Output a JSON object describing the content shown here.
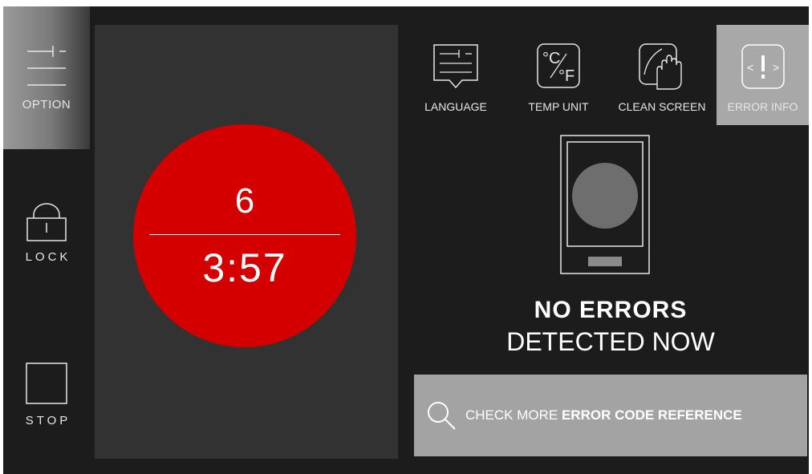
{
  "sidebar": {
    "option_label": "OPTION",
    "lock_label": "LOCK",
    "stop_label": "STOP",
    "option_icon": "option-sliders-icon",
    "lock_icon": "lock-icon",
    "stop_icon": "stop-square-icon"
  },
  "timer": {
    "count": "6",
    "time": "3:57",
    "circle_color": "#d40000"
  },
  "tabs": [
    {
      "label": "LANGUAGE",
      "icon": "language-speech-icon"
    },
    {
      "label": "TEMP UNIT",
      "icon": "temp-unit-icon"
    },
    {
      "label": "CLEAN SCREEN",
      "icon": "clean-screen-hand-icon"
    },
    {
      "label": "ERROR INFO",
      "icon": "error-info-icon",
      "active": true
    }
  ],
  "status": {
    "title": "NO ERRORS",
    "subtitle": "DETECTED NOW"
  },
  "reference_button": {
    "prefix": "CHECK MORE ",
    "emphasis": "ERROR CODE REFERENCE",
    "icon": "search-icon"
  },
  "device_icons": {
    "temp_c": "°C",
    "temp_f": "°F"
  },
  "colors": {
    "background": "#1c1c1c",
    "panel": "#323232",
    "active_tab": "#a8a8a8",
    "reference_button": "#a3a3a3"
  }
}
